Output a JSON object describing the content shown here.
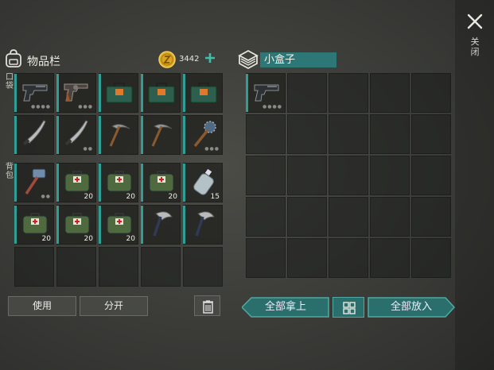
{
  "header": {
    "close_label": "关闭"
  },
  "inventory": {
    "title": "物品栏",
    "coins": "3442",
    "pocket_label": "口袋",
    "backpack_label": "背包",
    "pocket_slots": [
      {
        "item": "pistol-icon",
        "count": "",
        "durability": "●●●●"
      },
      {
        "item": "revolver-icon",
        "count": "",
        "durability": "●●●"
      },
      {
        "item": "ammo-box-icon",
        "count": "",
        "durability": ""
      },
      {
        "item": "ammo-box-icon",
        "count": "",
        "durability": ""
      },
      {
        "item": "ammo-box-icon",
        "count": "",
        "durability": ""
      },
      {
        "item": "machete-icon",
        "count": "",
        "durability": ""
      },
      {
        "item": "machete-icon",
        "count": "",
        "durability": "●●"
      },
      {
        "item": "pickaxe-icon",
        "count": "",
        "durability": ""
      },
      {
        "item": "pickaxe-icon",
        "count": "",
        "durability": ""
      },
      {
        "item": "spiked-club-icon",
        "count": "",
        "durability": "●●●"
      }
    ],
    "backpack_slots": [
      {
        "item": "sledgehammer-icon",
        "count": "",
        "durability": "●●"
      },
      {
        "item": "medkit-bag-icon",
        "count": "20",
        "durability": ""
      },
      {
        "item": "medkit-bag-icon",
        "count": "20",
        "durability": ""
      },
      {
        "item": "medkit-bag-icon",
        "count": "20",
        "durability": ""
      },
      {
        "item": "water-bottle-icon",
        "count": "15",
        "durability": ""
      },
      {
        "item": "medkit-bag-icon",
        "count": "20",
        "durability": ""
      },
      {
        "item": "medkit-bag-icon",
        "count": "20",
        "durability": ""
      },
      {
        "item": "medkit-bag-icon",
        "count": "20",
        "durability": ""
      },
      {
        "item": "hatchet-icon",
        "count": "",
        "durability": ""
      },
      {
        "item": "hatchet-icon",
        "count": "",
        "durability": ""
      },
      {
        "item": "",
        "count": "",
        "durability": ""
      },
      {
        "item": "",
        "count": "",
        "durability": ""
      },
      {
        "item": "",
        "count": "",
        "durability": ""
      },
      {
        "item": "",
        "count": "",
        "durability": ""
      },
      {
        "item": "",
        "count": "",
        "durability": ""
      }
    ],
    "use_label": "使用",
    "split_label": "分开"
  },
  "box": {
    "name": "小盒子",
    "slots": [
      {
        "item": "pistol-icon",
        "count": "",
        "durability": "●●●●"
      }
    ],
    "take_all_label": "全部拿上",
    "put_all_label": "全部放入"
  },
  "colors": {
    "accent": "#2e9f95",
    "button_teal": "#2a6f6b"
  }
}
